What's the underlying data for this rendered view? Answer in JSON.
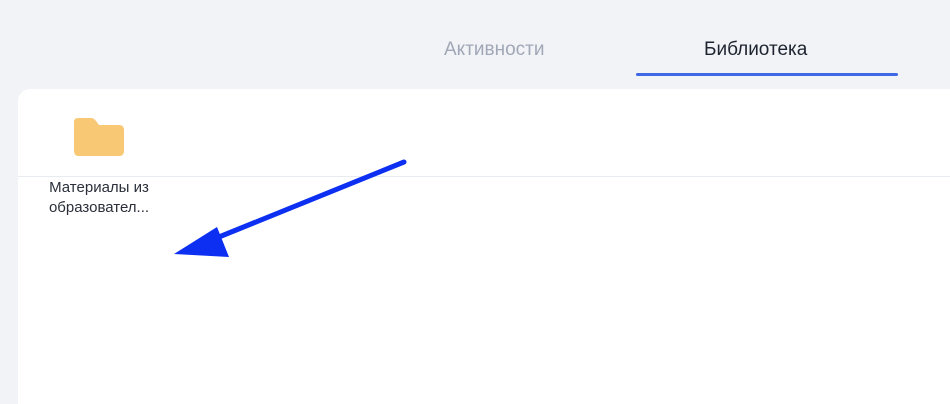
{
  "tabs": [
    {
      "label": "Активности",
      "active": false
    },
    {
      "label": "Библиотека",
      "active": true
    }
  ],
  "colors": {
    "accent": "#3f68e6",
    "inactive_tab": "#a1a7b7",
    "folder": "#f8c874",
    "arrow": "#0c2ff2"
  },
  "library": {
    "items": [
      {
        "type": "folder",
        "icon": "folder-icon",
        "label_line1": "Материалы из",
        "label_line2": "образовател..."
      }
    ]
  }
}
